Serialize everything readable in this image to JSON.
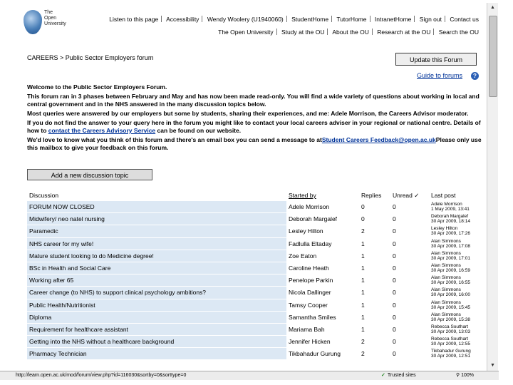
{
  "header": {
    "logo_text": "The Open University",
    "nav_top": [
      "Listen to this page",
      "Accessibility",
      "Wendy Woolery (U1940060)",
      "StudentHome",
      "TutorHome",
      "IntranetHome",
      "Sign out",
      "Contact us"
    ],
    "nav_bottom": [
      "The Open University",
      "Study at the OU",
      "About the OU",
      "Research at the OU",
      "Search the OU"
    ]
  },
  "breadcrumb": "CAREERS > Public Sector Employers forum",
  "update_button": "Update this Forum",
  "guide_link": "Guide to forums",
  "intro": {
    "p1": "Welcome to the Public Sector Employers Forum.",
    "p2": "This forum ran in 3 phases between February and May and has now been made read-only.  You will find a wide variety of questions about working in local and central government and in the NHS answered in the many discussion topics below.",
    "p3": "Most queries were answered by our employers but some by students, sharing their experiences, and me: Adele Morrison, the Careers Advisor moderator.",
    "p4_a": "If you do not find the answer to your query here in the forum you might like to contact your local careers adviser in your regional or national centre.  Details of how to ",
    "p4_link": "contact the Careers Advisory Service",
    "p4_b": " can be found on our website.",
    "p5_a": "We'd love to know what you think of this forum and there's an email box you can send a message to at",
    "p5_link": "Student Careers Feedback@open.ac.uk",
    "p5_b": "Please only use this mailbox to give your feedback on this forum."
  },
  "add_button": "Add a new discussion topic",
  "table": {
    "headers": [
      "Discussion",
      "Started by",
      "Replies",
      "Unread ✓",
      "Last post"
    ],
    "rows": [
      {
        "topic": "FORUM NOW CLOSED",
        "by": "Adele Morrison",
        "replies": "0",
        "unread": "0",
        "last1": "Adele Morrison",
        "last2": "1 May 2009, 13:41"
      },
      {
        "topic": "Midwifery/ neo natel nursing",
        "by": "Deborah Margalef",
        "replies": "0",
        "unread": "0",
        "last1": "Deborah Margalef",
        "last2": "30 Apr 2009, 18:14"
      },
      {
        "topic": "Paramedic",
        "by": "Lesley Hilton",
        "replies": "2",
        "unread": "0",
        "last1": "Lesley Hilton",
        "last2": "30 Apr 2009, 17:26"
      },
      {
        "topic": "NHS career for my wife!",
        "by": "Fadlulla Eltaday",
        "replies": "1",
        "unread": "0",
        "last1": "Alan Simmons",
        "last2": "30 Apr 2009, 17:08"
      },
      {
        "topic": "Mature student looking to do Medicine degree!",
        "by": "Zoe Eaton",
        "replies": "1",
        "unread": "0",
        "last1": "Alan Simmons",
        "last2": "30 Apr 2009, 17:01"
      },
      {
        "topic": "BSc in Health and Social Care",
        "by": "Caroline Heath",
        "replies": "1",
        "unread": "0",
        "last1": "Alan Simmons",
        "last2": "30 Apr 2009, 16:59"
      },
      {
        "topic": "Working after 65",
        "by": "Penelope Parkin",
        "replies": "1",
        "unread": "0",
        "last1": "Alan Simmons",
        "last2": "30 Apr 2009, 16:55"
      },
      {
        "topic": "Career change (to NHS) to support clinical psychology ambitions?",
        "by": "Nicola Dallinger",
        "replies": "1",
        "unread": "0",
        "last1": "Alan Simmons",
        "last2": "30 Apr 2009, 16:00"
      },
      {
        "topic": "Public Health/Nutritionist",
        "by": "Tamsy Cooper",
        "replies": "1",
        "unread": "0",
        "last1": "Alan Simmons",
        "last2": "30 Apr 2009, 15:45"
      },
      {
        "topic": "Diploma",
        "by": "Samantha Smiles",
        "replies": "1",
        "unread": "0",
        "last1": "Alan Simmons",
        "last2": "30 Apr 2009, 15:38"
      },
      {
        "topic": "Requirement for healthcare assistant",
        "by": "Mariama Bah",
        "replies": "1",
        "unread": "0",
        "last1": "Rebecca Southart",
        "last2": "30 Apr 2009, 13:03"
      },
      {
        "topic": "Getting into the NHS without a healthcare background",
        "by": "Jennifer Hicken",
        "replies": "2",
        "unread": "0",
        "last1": "Rebecca Southart",
        "last2": "30 Apr 2009, 12:55"
      },
      {
        "topic": "Pharmacy Technician",
        "by": "Tikbahadur Gurung",
        "replies": "2",
        "unread": "0",
        "last1": "Tikbahadur Gurung",
        "last2": "30 Apr 2009, 12:51"
      }
    ]
  },
  "statusbar": {
    "url": "http://learn.open.ac.uk/mod/forum/view.php?id=116030&sortby=0&sorttype=0",
    "zone": "Trusted sites",
    "zoom": "100%"
  }
}
